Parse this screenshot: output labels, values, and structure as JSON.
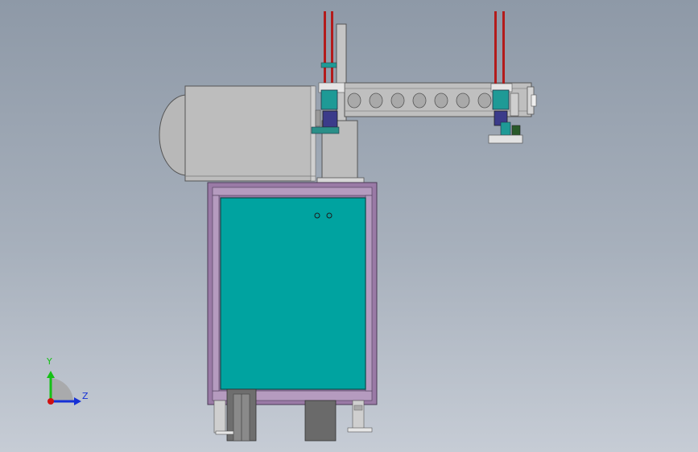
{
  "viewport": {
    "background_top": "#8e99a7",
    "background_bottom": "#c6ccd5",
    "model_view": "front"
  },
  "colors": {
    "frame_purple": "#9a7aa6",
    "panel_teal": "#00a3a0",
    "motor_gray": "#b9b9b9",
    "hose_red": "#b31b1b",
    "valve_teal": "#1e9a96",
    "block_navy": "#3b3b8a"
  },
  "triad": {
    "y_label": "Y",
    "z_label": "Z",
    "y_color": "#15c015",
    "z_color": "#1530d6",
    "x_color": "#d01010"
  }
}
